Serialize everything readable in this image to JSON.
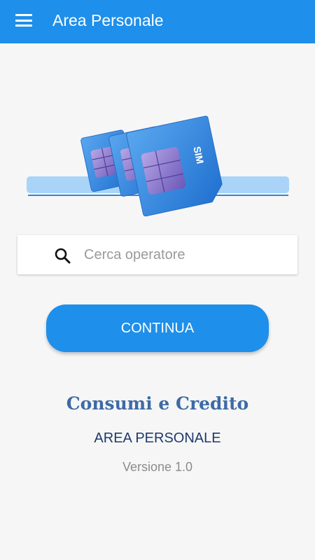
{
  "appbar": {
    "menu_icon": "hamburger-menu-icon",
    "title": "Area Personale",
    "color": "#1e8fea"
  },
  "illustration": {
    "icon": "sim-cards-illustration",
    "card_label": "SIM"
  },
  "search": {
    "icon": "search-icon",
    "placeholder": "Cerca operatore",
    "value": ""
  },
  "actions": {
    "continue_label": "CONTINUA"
  },
  "footer": {
    "app_name": "Consumi e Credito",
    "subtitle": "AREA PERSONALE",
    "version": "Versione 1.0"
  }
}
